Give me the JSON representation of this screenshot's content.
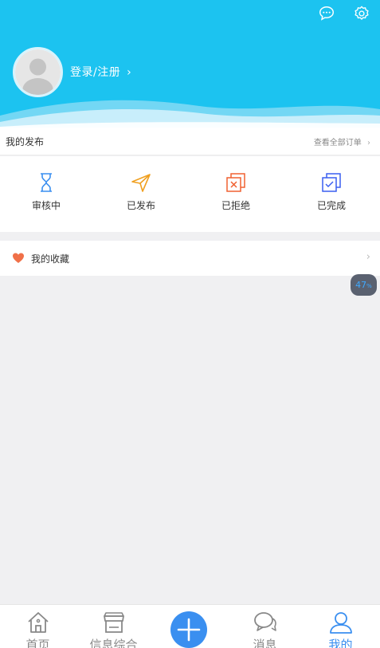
{
  "header": {
    "login_label": "登录/注册",
    "login_chevron": "›",
    "background_color": "#1cc3f0"
  },
  "my_publish": {
    "title": "我的发布",
    "view_all_label": "查看全部订单",
    "view_all_chevron": "›",
    "statuses": [
      {
        "label": "审核中",
        "icon": "hourglass-icon",
        "color": "#3a8ff0"
      },
      {
        "label": "已发布",
        "icon": "paper-plane-icon",
        "color": "#f0a020"
      },
      {
        "label": "已拒绝",
        "icon": "reject-icon",
        "color": "#f06030"
      },
      {
        "label": "已完成",
        "icon": "complete-icon",
        "color": "#3a5ff0"
      }
    ]
  },
  "favorites": {
    "label": "我的收藏",
    "chevron": "›",
    "icon": "heart-icon",
    "icon_color": "#f07048"
  },
  "progress_badge": {
    "value": "47",
    "unit": "%"
  },
  "bottom_nav": {
    "items": [
      {
        "label": "首页",
        "icon": "home-icon"
      },
      {
        "label": "信息综合",
        "icon": "store-icon"
      },
      {
        "label": "",
        "icon": "plus-icon"
      },
      {
        "label": "消息",
        "icon": "chat-icon"
      },
      {
        "label": "我的",
        "icon": "user-icon",
        "active": true
      }
    ],
    "active_color": "#3a8ff0"
  }
}
